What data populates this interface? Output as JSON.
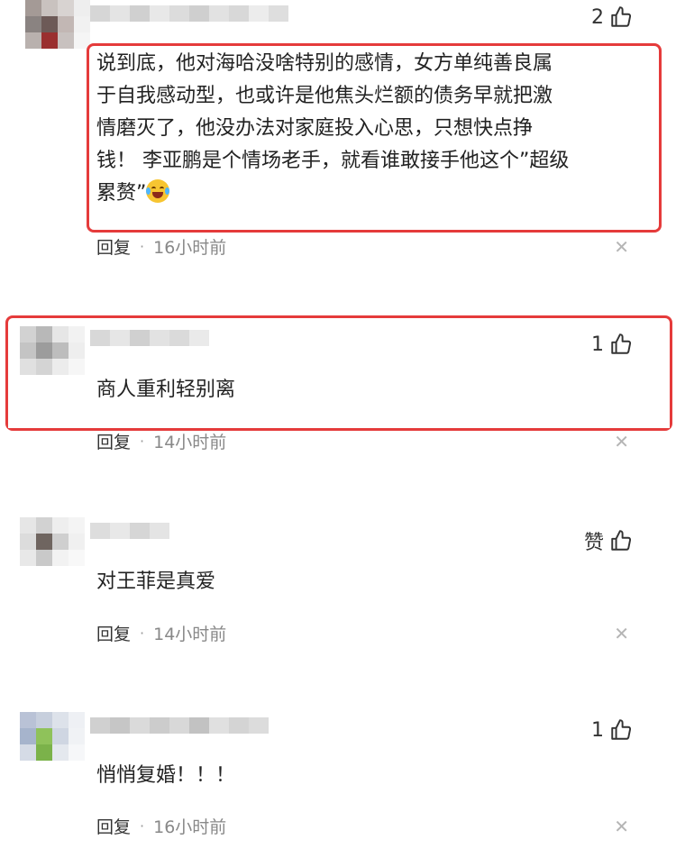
{
  "comments": [
    {
      "likes": "2",
      "text_lines": [
        "说到底，他对海哈没啥特别的感情，女方单纯善良属",
        "于自我感动型，也或许是他焦头烂额的债务早就把激",
        "情磨灭了，他没办法对家庭投入心思，只想快点挣",
        "钱！ 李亚鹏是个情场老手，就看谁敢接手他这个”超级",
        "累赘”"
      ],
      "reply": "回复",
      "time": "16小时前",
      "emoji": "laugh-cry-emoji"
    },
    {
      "likes": "1",
      "text": "商人重利轻别离",
      "reply": "回复",
      "time": "14小时前"
    },
    {
      "likes": "赞",
      "text": "对王菲是真爱",
      "reply": "回复",
      "time": "14小时前"
    },
    {
      "likes": "1",
      "text": "悄悄复婚！！！",
      "reply": "回复",
      "time": "16小时前"
    }
  ],
  "icons": {
    "like": "thumbs-up-icon",
    "close": "close-icon"
  },
  "colors": {
    "highlight_border": "#e53b3b",
    "time_text": "#888888"
  }
}
